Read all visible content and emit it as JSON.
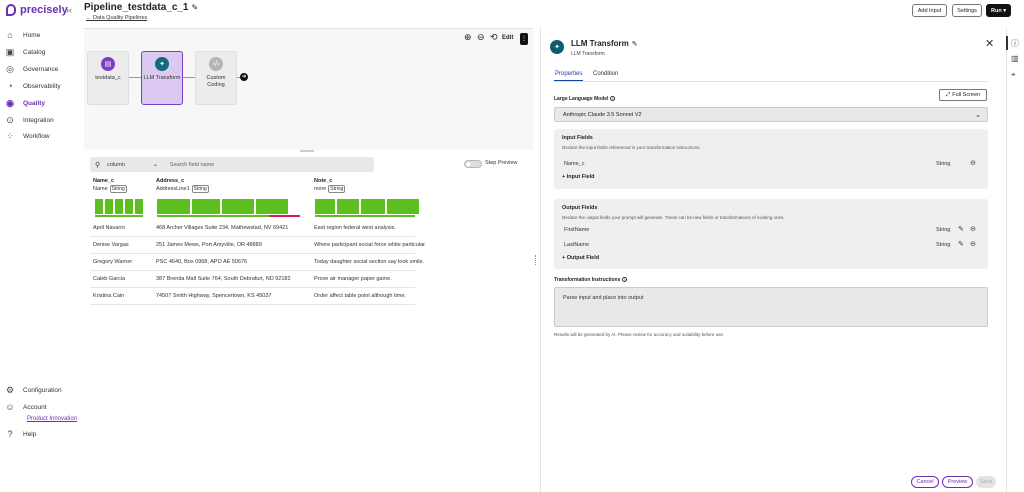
{
  "brand": {
    "name": "precisely",
    "collapse": "›‹",
    "color": "#6b2fb3"
  },
  "nav": {
    "items": [
      {
        "label": "Home",
        "icon": "home-icon",
        "glyph": "⌂"
      },
      {
        "label": "Catalog",
        "icon": "catalog-icon",
        "glyph": "▣"
      },
      {
        "label": "Governance",
        "icon": "governance-icon",
        "glyph": "◎"
      },
      {
        "label": "Observability",
        "icon": "observability-icon",
        "glyph": "◔"
      },
      {
        "label": "Quality",
        "icon": "quality-icon",
        "glyph": "◉"
      },
      {
        "label": "Integration",
        "icon": "integration-icon",
        "glyph": "⊙"
      },
      {
        "label": "Workflow",
        "icon": "workflow-icon",
        "glyph": "⁘"
      }
    ],
    "active": "Quality",
    "bottom": [
      {
        "label": "Configuration",
        "icon": "gear-icon",
        "glyph": "⚙"
      },
      {
        "label": "Account",
        "icon": "account-icon",
        "glyph": "☺"
      },
      {
        "label": "Help",
        "icon": "help-icon",
        "glyph": "?"
      }
    ],
    "link": "Product Innovation"
  },
  "header": {
    "title": "Pipeline_testdata_c_1",
    "breadcrumb": "← Data Quality Pipelines",
    "buttons": {
      "add_input": "Add Input",
      "settings": "Settings",
      "run": "Run ▾"
    }
  },
  "canvas": {
    "edit": "Edit",
    "more": "⋮",
    "nodes": [
      {
        "label": "testdata_c",
        "icon": "dataset-icon",
        "color": "#7c3ec2"
      },
      {
        "label": "LLM Transform",
        "icon": "llm-transform-icon",
        "color": "#0f6e7e"
      },
      {
        "label": "Custom\nCoding",
        "icon": "code-icon",
        "color": "#b5b5b5"
      }
    ]
  },
  "data_panel": {
    "search": {
      "column": "column",
      "placeholder": "Search field name"
    },
    "step_preview": "Step Preview",
    "columns": [
      {
        "name": "Name_c",
        "sub": "Name",
        "type": "String"
      },
      {
        "name": "Address_c",
        "sub": "AddressLine1",
        "type": "String"
      },
      {
        "name": "Note_c",
        "sub": "none",
        "type": "String"
      }
    ],
    "rows": [
      [
        "April Navarro",
        "468 Archer Villages Suite 234, Mathewstad, NV 69421",
        "East region federal west analysis."
      ],
      [
        "Denise Vargas",
        "251 James Mews, Port Amyville, OR 48889",
        "Where participant social force white particular."
      ],
      [
        "Gregory Warner",
        "PSC 4640, Box 0968, APO AE 50676",
        "Today daughter social section say look smile."
      ],
      [
        "Caleb Garcia",
        "387 Brenda Mall Suite 764, South Debrafurt, ND 92182",
        "Prove air manager paper game."
      ],
      [
        "Kristina Cain",
        "74507 Smith Highway, Spencertown, KS 45037",
        "Order affect table point although time."
      ]
    ]
  },
  "panel": {
    "title": "LLM Transform",
    "subtitle": "LLM Transform",
    "tabs": [
      "Properties",
      "Condition"
    ],
    "llm_label": "Large Language Model",
    "full_screen": "Full Screen",
    "model": "Anthropic Claude 3.5 Sonnet V2",
    "input_fields": {
      "title": "Input Fields",
      "desc": "Declare the input fields referenced in your transformation instructions.",
      "items": [
        {
          "name": "Name_c",
          "type": "String"
        }
      ],
      "add": "+ Input Field"
    },
    "output_fields": {
      "title": "Output Fields",
      "desc": "Declare the output fields your prompt will generate. These can be new fields or transformations of existing ones.",
      "items": [
        {
          "name": "FirstName",
          "type": "String"
        },
        {
          "name": "LastName",
          "type": "String"
        }
      ],
      "add": "+ Output Field"
    },
    "instructions_label": "Transformation Instructions",
    "instructions": "Parse input and place into output",
    "disclaimer": "Results will be generated by AI. Please review for accuracy and suitability before use.",
    "buttons": {
      "cancel": "Cancel",
      "preview": "Preview",
      "save": "Save"
    }
  }
}
